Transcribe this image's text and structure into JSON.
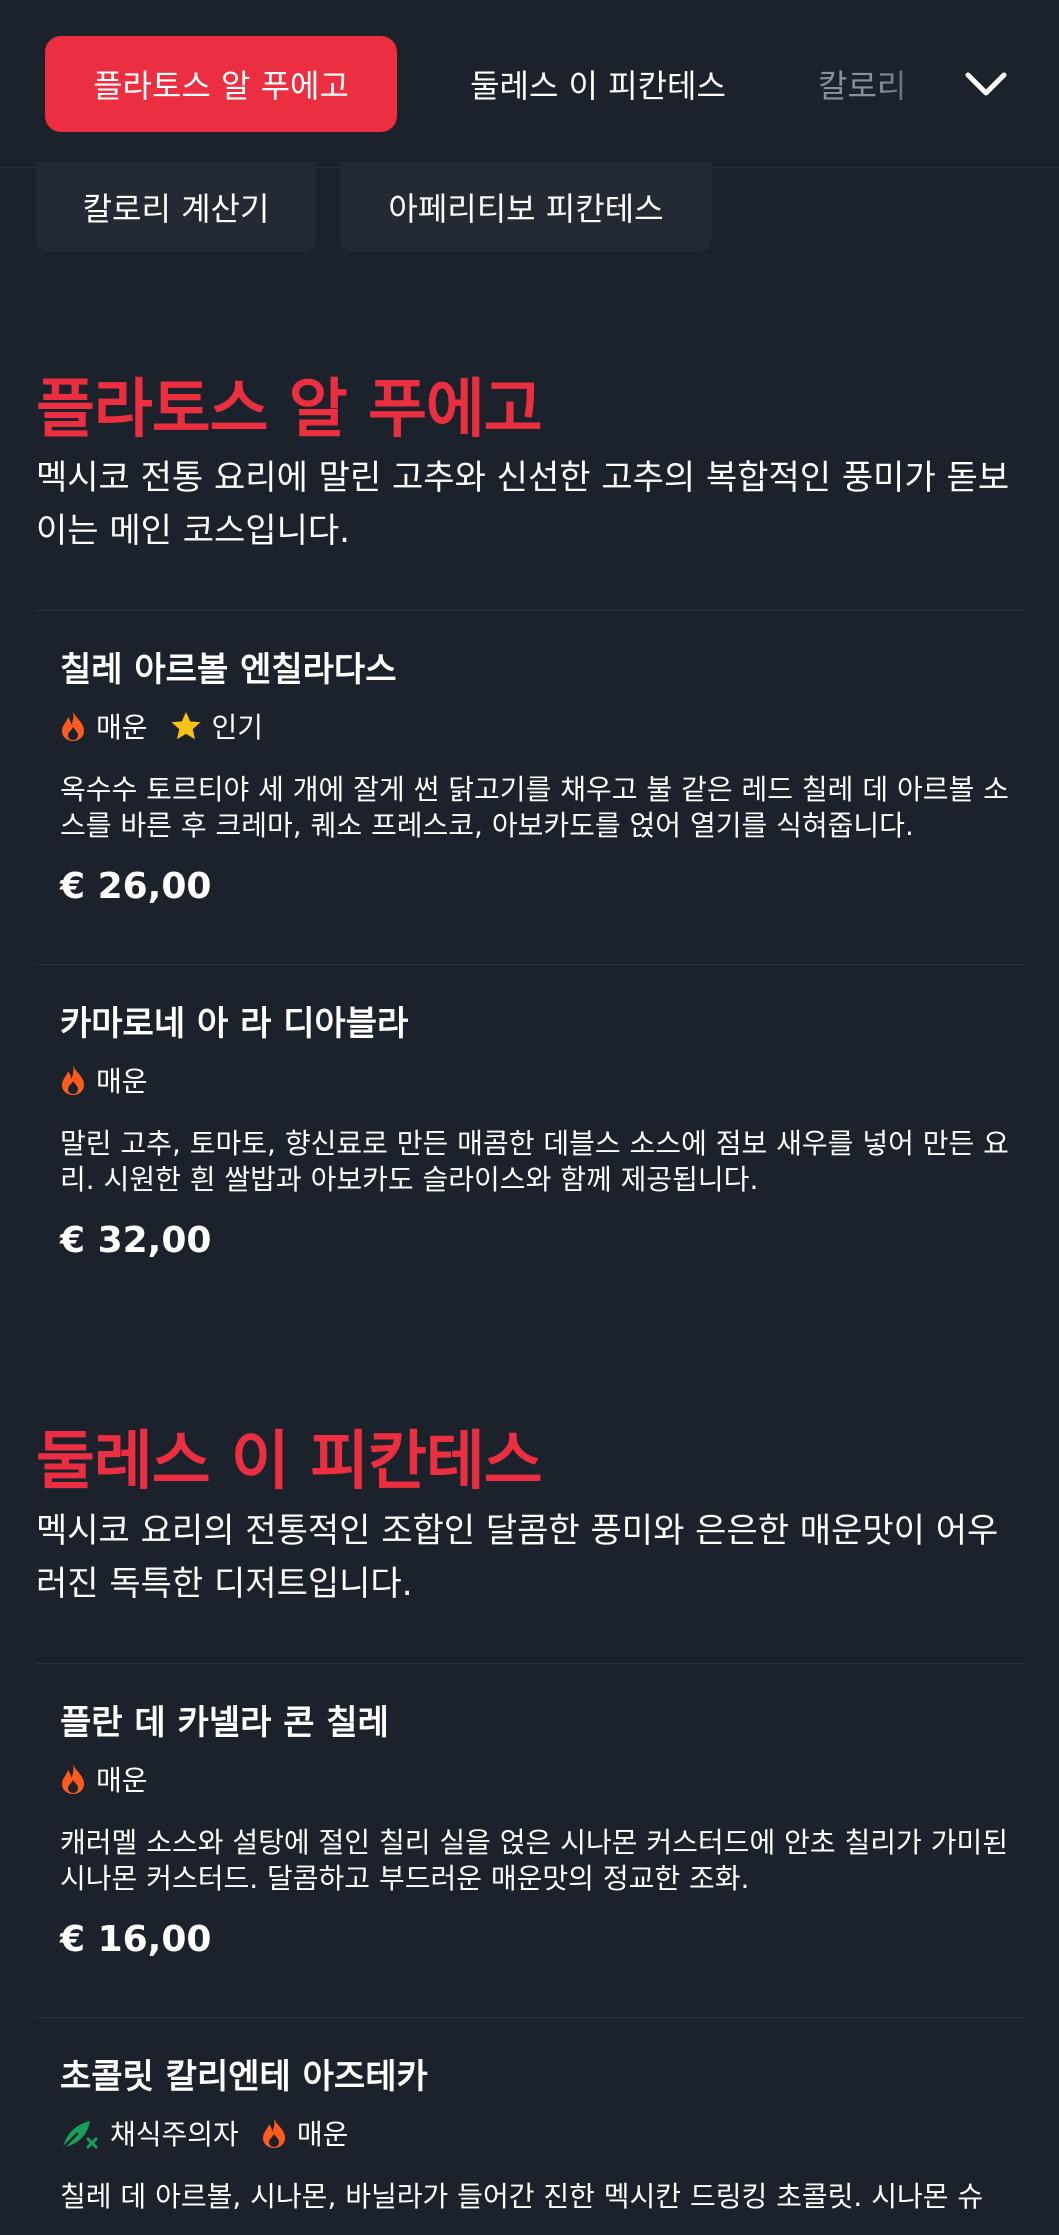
{
  "nav": {
    "tabs": [
      {
        "label": "플라토스 알 푸에고",
        "active": true
      },
      {
        "label": "둘레스 이 피칸테스",
        "active": false
      },
      {
        "label": "칼로리",
        "active": false
      }
    ],
    "more_icon": "chevron-down-icon"
  },
  "pills": [
    {
      "label": "칼로리 계산기"
    },
    {
      "label": "아페리티보 피칸테스"
    }
  ],
  "sections": [
    {
      "title": "플라토스 알 푸에고",
      "description": "멕시코 전통 요리에 말린 고추와 신선한 고추의 복합적인 풍미가 돋보이는 메인 코스입니다.",
      "items": [
        {
          "name": "칠레 아르볼 엔칠라다스",
          "tags": [
            {
              "label": "매운",
              "icon": "flame-icon"
            },
            {
              "label": "인기",
              "icon": "star-icon"
            }
          ],
          "description": "옥수수 토르티야 세 개에 잘게 썬 닭고기를 채우고 불 같은 레드 칠레 데 아르볼 소스를 바른 후 크레마, 퀘소 프레스코, 아보카도를 얹어 열기를 식혀줍니다.",
          "price": "€ 26,00"
        },
        {
          "name": "카마로네 아 라 디아블라",
          "tags": [
            {
              "label": "매운",
              "icon": "flame-icon"
            }
          ],
          "description": "말린 고추, 토마토, 향신료로 만든 매콤한 데블스 소스에 점보 새우를 넣어 만든 요리. 시원한 흰 쌀밥과 아보카도 슬라이스와 함께 제공됩니다.",
          "price": "€ 32,00"
        }
      ]
    },
    {
      "title": "둘레스 이 피칸테스",
      "description": "멕시코 요리의 전통적인 조합인 달콤한 풍미와 은은한 매운맛이 어우러진 독특한 디저트입니다.",
      "items": [
        {
          "name": "플란 데 카넬라 콘 칠레",
          "tags": [
            {
              "label": "매운",
              "icon": "flame-icon"
            }
          ],
          "description": "캐러멜 소스와 설탕에 절인 칠리 실을 얹은 시나몬 커스터드에 안초 칠리가 가미된 시나몬 커스터드. 달콤하고 부드러운 매운맛의 정교한 조화.",
          "price": "€ 16,00"
        },
        {
          "name": "초콜릿 칼리엔테 아즈테카",
          "tags": [
            {
              "label": "채식주의자",
              "icon": "vegetarian-leaf-icon"
            },
            {
              "label": "매운",
              "icon": "flame-icon"
            }
          ],
          "description": "칠레 데 아르볼, 시나몬, 바닐라가 들어간 진한 멕시칸 드링킹 초콜릿. 시나몬 슈",
          "price": ""
        }
      ]
    }
  ],
  "colors": {
    "background": "#1b222c",
    "accent": "#ec2f40",
    "pill_bg": "#242a33",
    "flame": "#ff5a1f",
    "star": "#f7c21a",
    "veg": "#18a05a"
  }
}
